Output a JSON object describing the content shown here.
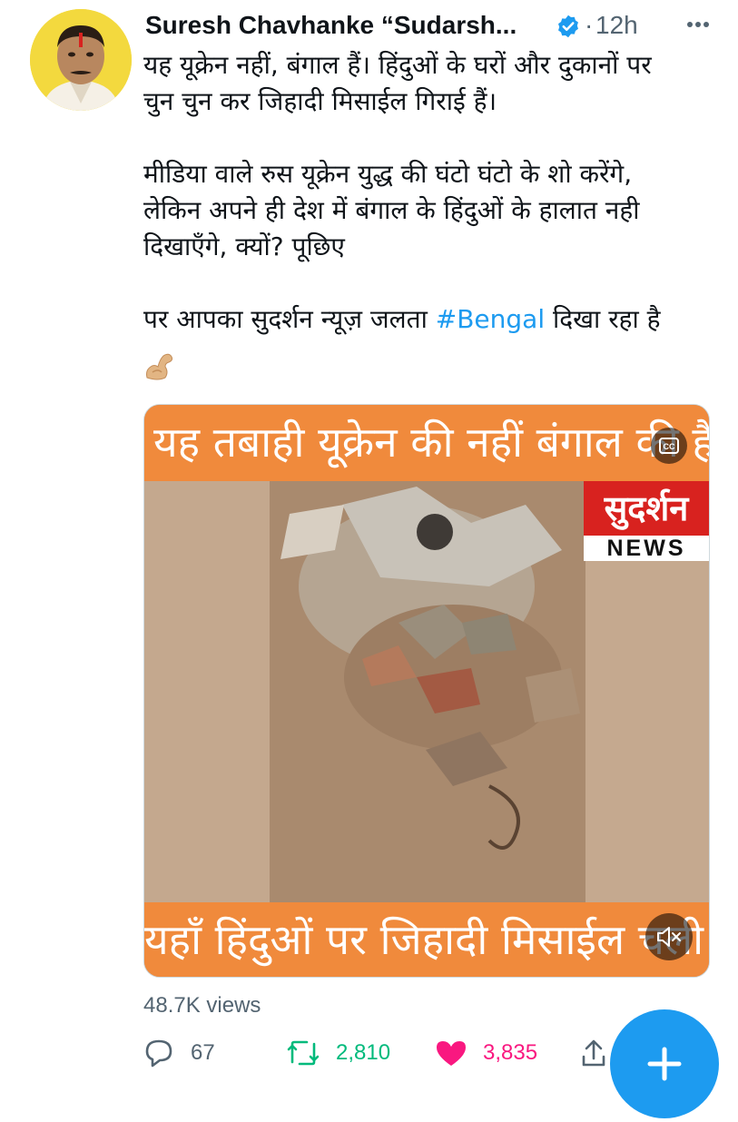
{
  "tweet": {
    "author": {
      "name": "Suresh Chavhanke “Sudarsh...",
      "verified": true
    },
    "separator": "·",
    "time": "12h",
    "text": {
      "line1": "यह यूक्रेन नहीं, बंगाल हैं। हिंदुओं के घरों और दुकानों पर",
      "line2": "चुन चुन कर जिहादी मिसाईल गिराई हैं।",
      "line3": "मीडिया वाले रुस यूक्रेन युद्ध की घंटो घंटो के शो करेंगे,",
      "line4": "लेकिन अपने ही देश में बंगाल के हिंदुओं के हालात नही",
      "line5": "दिखाएँगे, क्यों? पूछिए",
      "line6_before": "पर आपका सुदर्शन न्यूज़ जलता ",
      "hashtag": "#Bengal",
      "line6_after": " दिखा रहा है"
    },
    "emoji": "flexed-biceps-icon",
    "media": {
      "top_caption": "यह तबाही यूक्रेन की नहीं बंगाल की है",
      "bottom_caption": "यहाँ हिंदुओं पर जिहादी मिसाईल चली है",
      "logo_text": "सुदर्शन",
      "logo_subtext": "NEWS"
    },
    "views": "48.7K views",
    "stats": {
      "replies": "67",
      "retweets": "2,810",
      "likes": "3,835"
    }
  },
  "colors": {
    "accent": "#1d9bf0",
    "retweet": "#00ba7c",
    "like": "#f91880",
    "banner": "#f08a3c",
    "logo_red": "#d8221f"
  }
}
